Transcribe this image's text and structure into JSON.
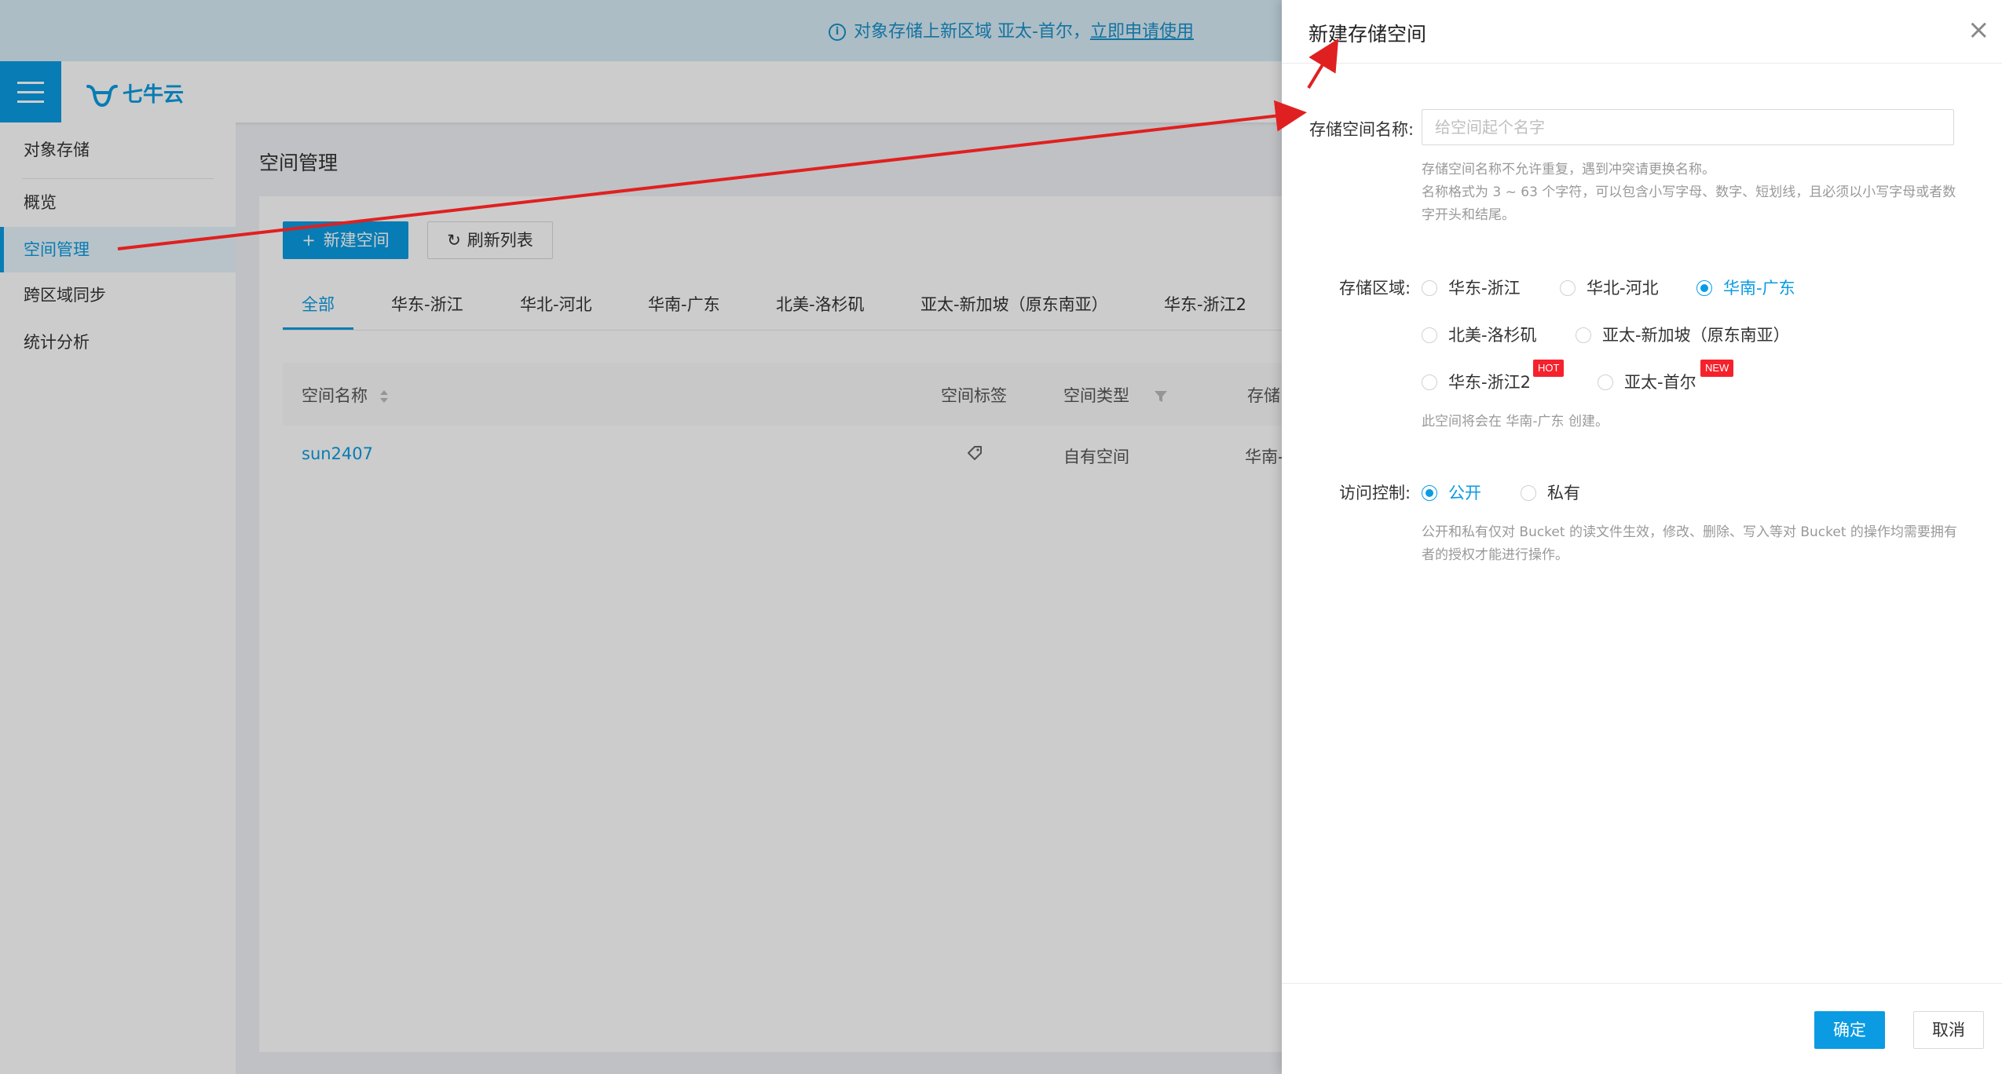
{
  "banner": {
    "info_icon": "i",
    "message": "对象存储上新区域 亚太-首尔，",
    "link": "立即申请使用"
  },
  "header": {
    "logo_text": "七牛云"
  },
  "sidebar": {
    "items": [
      {
        "label": "对象存储"
      },
      {
        "label": "概览"
      },
      {
        "label": "空间管理"
      },
      {
        "label": "跨区域同步"
      },
      {
        "label": "统计分析"
      }
    ]
  },
  "main": {
    "title": "空间管理",
    "new_button": "新建空间",
    "new_icon": "+",
    "refresh_button": "刷新列表",
    "refresh_icon": "↻",
    "tabs": [
      {
        "label": "全部"
      },
      {
        "label": "华东-浙江"
      },
      {
        "label": "华北-河北"
      },
      {
        "label": "华南-广东"
      },
      {
        "label": "北美-洛杉矶"
      },
      {
        "label": "亚太-新加坡（原东南亚）"
      },
      {
        "label": "华东-浙江2"
      }
    ],
    "table": {
      "headers": [
        "空间名称",
        "空间标签",
        "空间类型",
        "存储"
      ],
      "rows": [
        {
          "name": "sun2407",
          "type": "自有空间",
          "region": "华南-"
        }
      ]
    }
  },
  "drawer": {
    "title": "新建存储空间",
    "close_icon": "×",
    "name_label": "存储空间名称:",
    "name_placeholder": "给空间起个名字",
    "name_help_1": "存储空间名称不允许重复，遇到冲突请更换名称。",
    "name_help_2": "名称格式为 3 ~ 63 个字符，可以包含小写字母、数字、短划线，且必须以小写字母或者数字开头和结尾。",
    "region_label": "存储区域:",
    "regions": [
      {
        "label": "华东-浙江",
        "checked": false
      },
      {
        "label": "华北-河北",
        "checked": false
      },
      {
        "label": "华南-广东",
        "checked": true
      },
      {
        "label": "北美-洛杉矶",
        "checked": false
      },
      {
        "label": "亚太-新加坡（原东南亚）",
        "checked": false
      },
      {
        "label": "华东-浙江2",
        "checked": false,
        "badge": "HOT"
      },
      {
        "label": "亚太-首尔",
        "checked": false,
        "badge": "NEW"
      }
    ],
    "region_help": "此空间将会在 华南-广东 创建。",
    "access_label": "访问控制:",
    "access_options": [
      {
        "label": "公开",
        "checked": true
      },
      {
        "label": "私有",
        "checked": false
      }
    ],
    "access_help": "公开和私有仅对 Bucket 的读文件生效，修改、删除、写入等对 Bucket 的操作均需要拥有者的授权才能进行操作。",
    "ok_button": "确定",
    "cancel_button": "取消"
  },
  "colors": {
    "accent": "#0a9be2",
    "badge": "#f5222d",
    "annotation_arrow": "#e02020"
  }
}
